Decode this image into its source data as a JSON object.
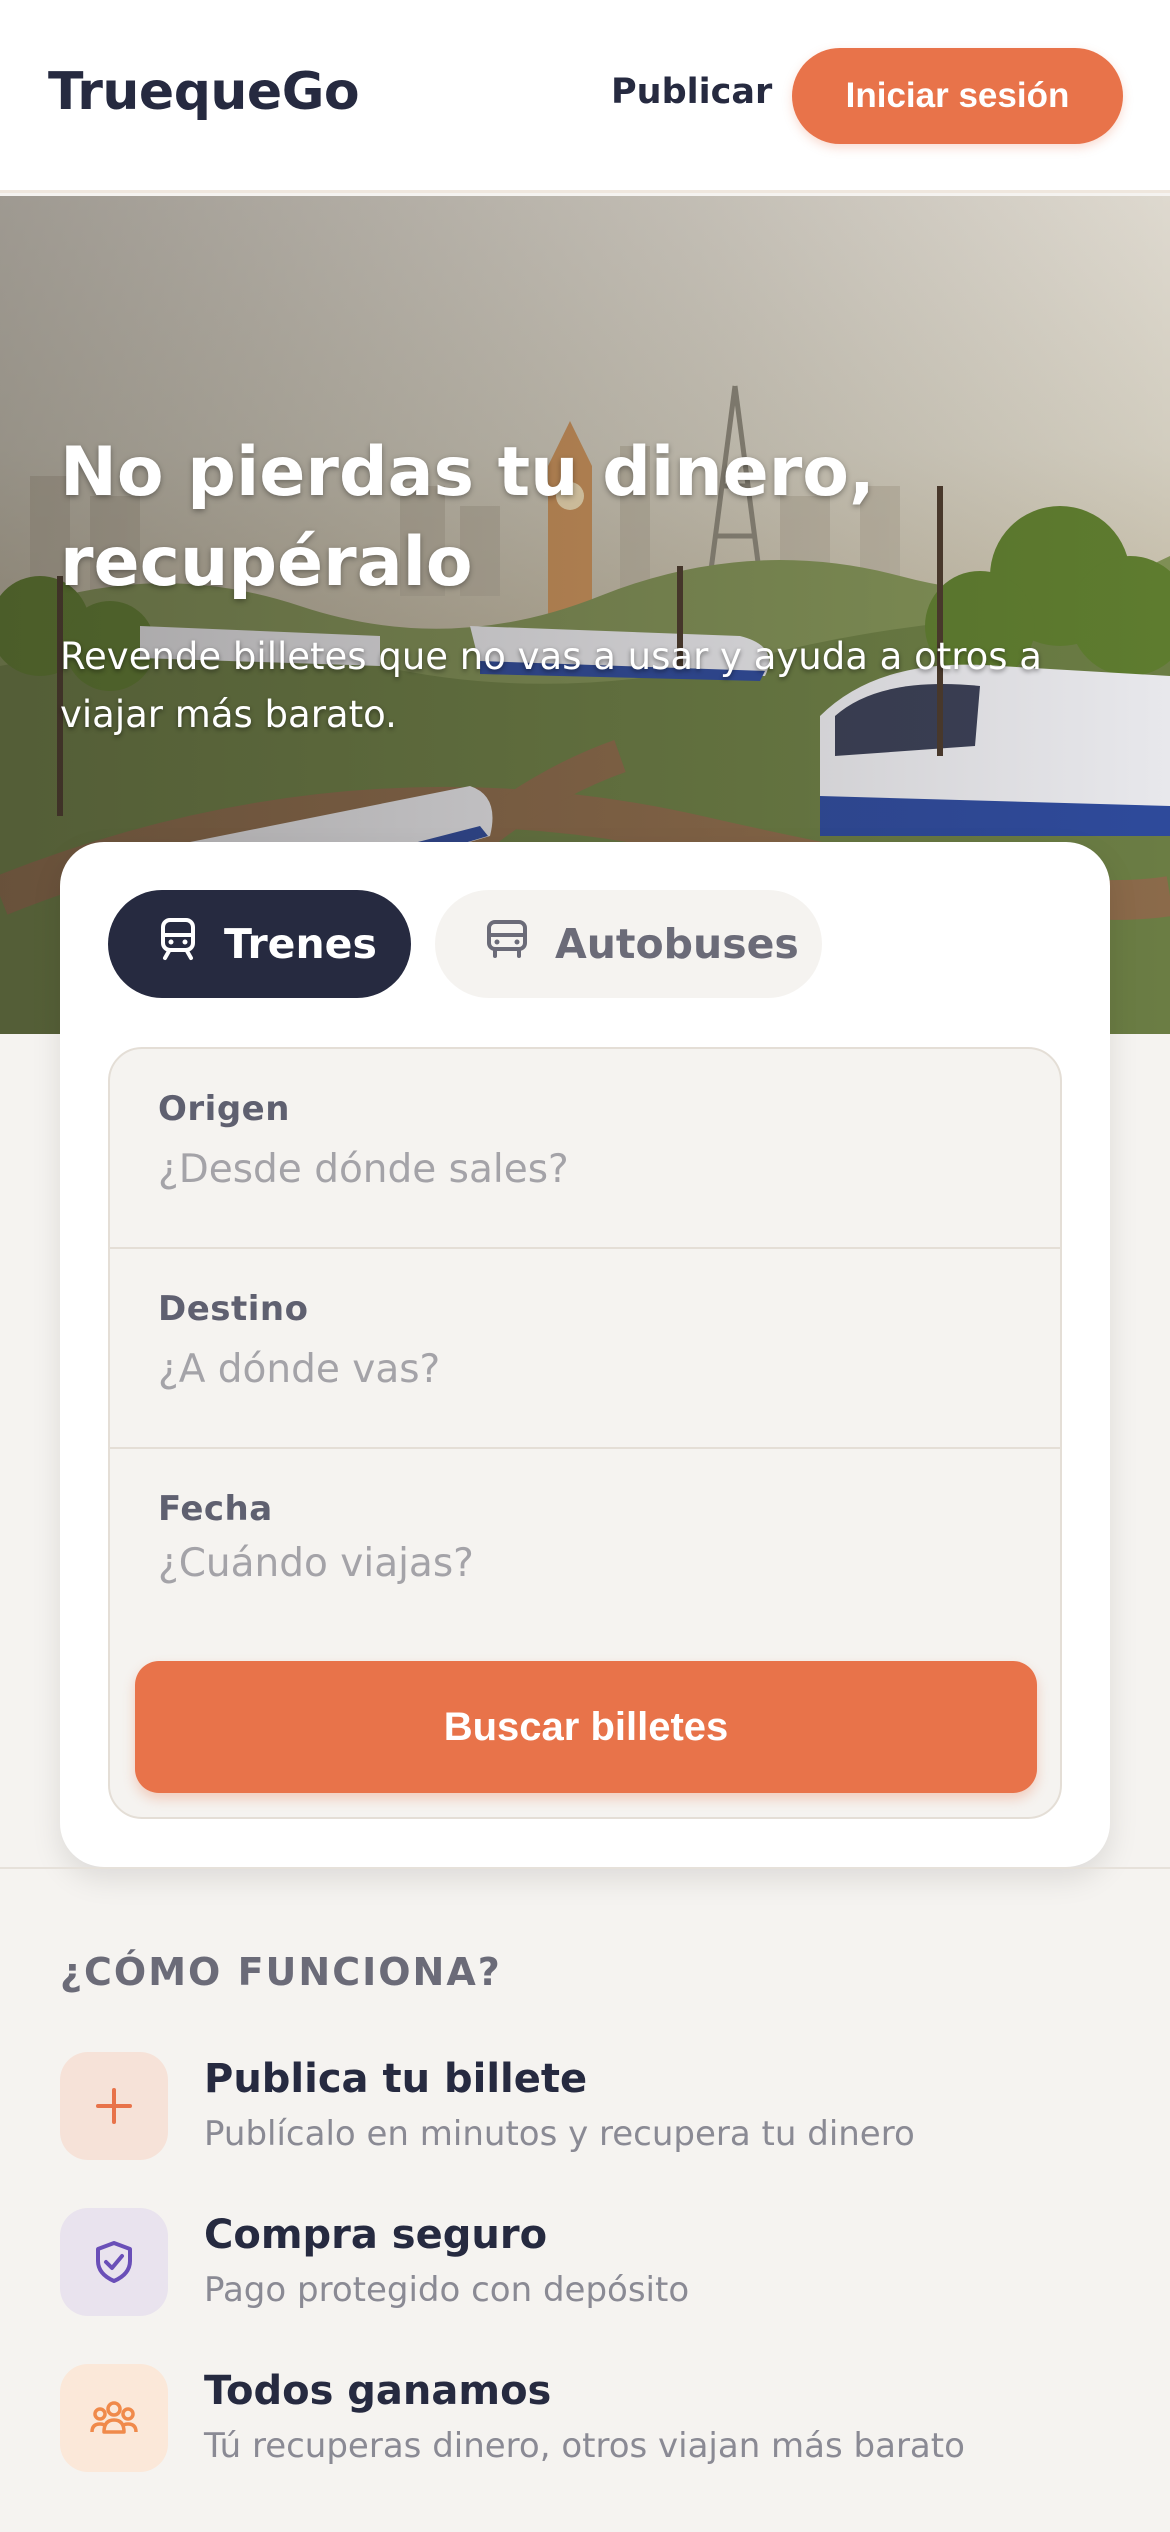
{
  "header": {
    "logo": "TruequeGo",
    "publish_label": "Publicar",
    "login_label": "Iniciar sesión"
  },
  "hero": {
    "title": "No pierdas tu dinero, recupéralo",
    "subtitle": "Revende billetes que no vas a usar y ayuda a otros a viajar más barato."
  },
  "search": {
    "tabs": [
      {
        "label": "Trenes",
        "icon": "train-icon",
        "selected": true
      },
      {
        "label": "Autobuses",
        "icon": "bus-icon",
        "selected": false
      }
    ],
    "fields": [
      {
        "label": "Origen",
        "placeholder": "¿Desde dónde sales?",
        "value": ""
      },
      {
        "label": "Destino",
        "placeholder": "¿A dónde vas?",
        "value": ""
      },
      {
        "label": "Fecha",
        "placeholder": "¿Cuándo viajas?",
        "value": ""
      }
    ],
    "button_label": "Buscar billetes"
  },
  "how": {
    "title": "¿CÓMO FUNCIONA?",
    "steps": [
      {
        "title": "Publica tu billete",
        "desc": "Publícalo en minutos y recupera tu dinero",
        "icon": "plus-icon",
        "color": "#e8734a"
      },
      {
        "title": "Compra seguro",
        "desc": "Pago protegido con depósito",
        "icon": "shield-check-icon",
        "color": "#6a4fb8"
      },
      {
        "title": "Todos ganamos",
        "desc": "Tú recuperas dinero, otros viajan más barato",
        "icon": "users-icon",
        "color": "#f08a4b"
      }
    ]
  },
  "colors": {
    "accent": "#e8734a",
    "dark": "#262a40",
    "background": "#f5f3f0"
  }
}
